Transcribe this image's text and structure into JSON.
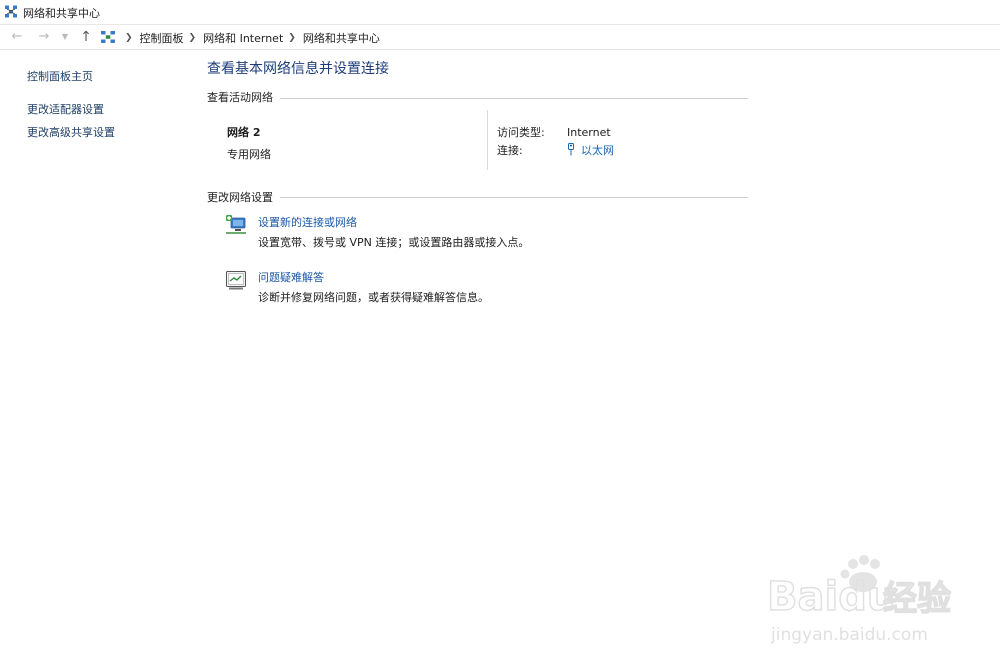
{
  "window": {
    "title": "网络和共享中心"
  },
  "nav": {
    "breadcrumbs": [
      "控制面板",
      "网络和 Internet",
      "网络和共享中心"
    ]
  },
  "left_pane": {
    "links": [
      "控制面板主页",
      "更改适配器设置",
      "更改高级共享设置"
    ]
  },
  "main": {
    "title": "查看基本网络信息并设置连接",
    "active_networks": {
      "heading": "查看活动网络",
      "network_name": "网络 2",
      "network_category": "专用网络",
      "access_type_label": "访问类型:",
      "access_type_value": "Internet",
      "connections_label": "连接:",
      "connections_value": "以太网"
    },
    "change_settings": {
      "heading": "更改网络设置",
      "tasks": [
        {
          "link": "设置新的连接或网络",
          "description": "设置宽带、拨号或 VPN 连接；或设置路由器或接入点。",
          "icon": "new-connection-icon"
        },
        {
          "link": "问题疑难解答",
          "description": "诊断并修复网络问题，或者获得疑难解答信息。",
          "icon": "troubleshoot-icon"
        }
      ]
    }
  },
  "watermark": {
    "brand": "Baidu",
    "brand_cn": "经验",
    "url": "jingyan.baidu.com"
  },
  "colors": {
    "link": "#1a5aa6",
    "title": "#1e3c7a",
    "rule": "#cfcfcf"
  }
}
